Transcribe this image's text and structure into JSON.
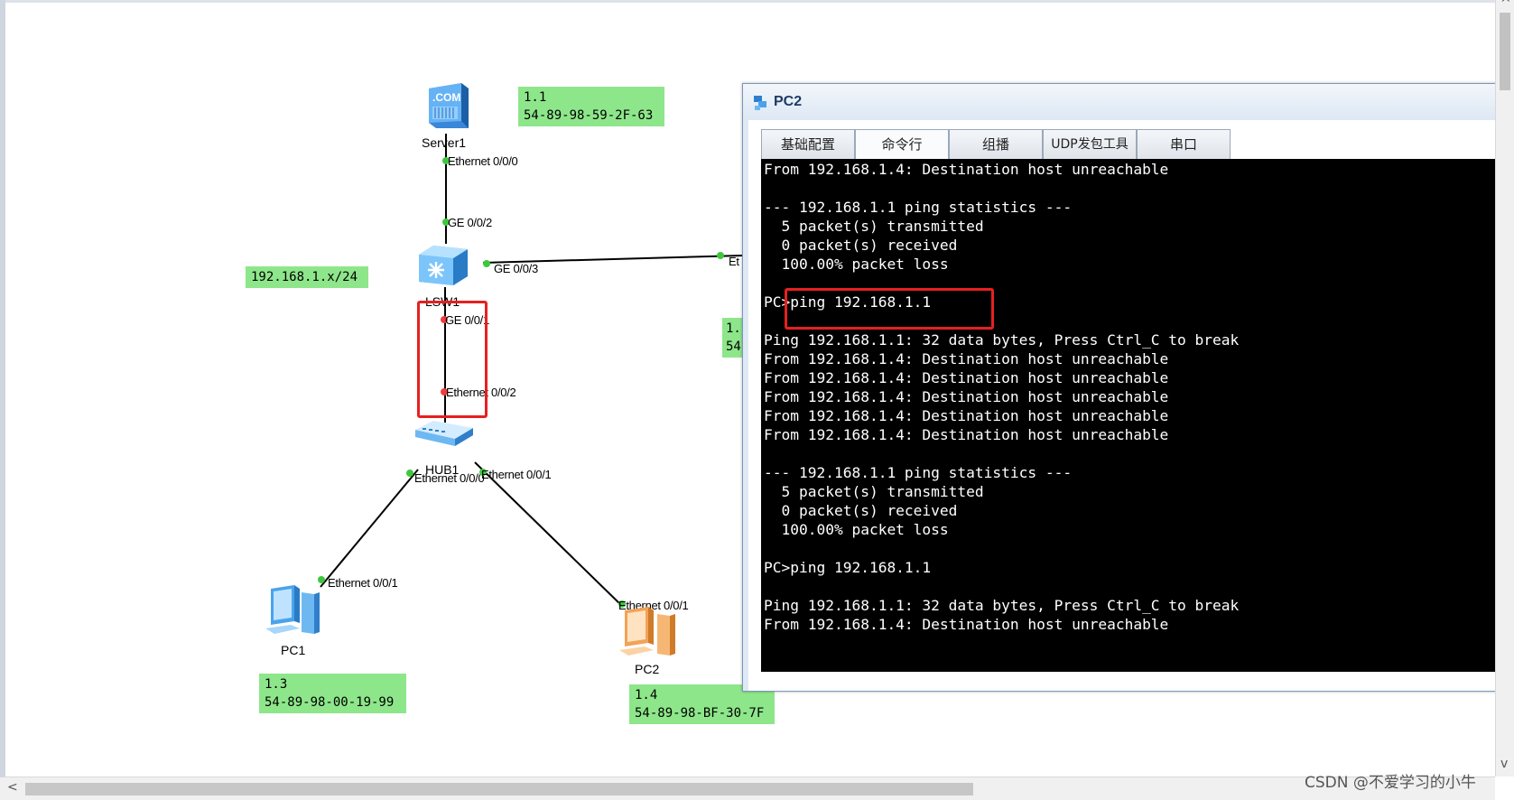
{
  "topology": {
    "devices": {
      "server1": "Server1",
      "lsw1": "LSW1",
      "hub1": "HUB1",
      "pc1": "PC1",
      "pc2": "PC2",
      "server_icon_text": ".COM"
    },
    "ports": {
      "server_eth": "Ethernet 0/0/0",
      "lsw_ge002": "GE 0/0/2",
      "lsw_ge003": "GE 0/0/3",
      "lsw_ge001": "GE 0/0/1",
      "hub_eth002": "Ethernet 0/0/2",
      "hub_eth000": "Ethernet 0/0/0",
      "hub_eth001": "Ethernet 0/0/1",
      "pc1_eth": "Ethernet 0/0/1",
      "pc2_eth": "Ethernet 0/0/1",
      "right_partial": "Et"
    },
    "notes": {
      "server_ip": "1.1",
      "server_mac": "54-89-98-59-2F-63",
      "subnet": "192.168.1.x/24",
      "pc1_ip": "1.3",
      "pc1_mac": "54-89-98-00-19-99",
      "pc2_ip": "1.4",
      "pc2_mac": "54-89-98-BF-30-7F",
      "hidden_ip": "1.",
      "hidden_mac": "54"
    },
    "colors": {
      "note_bg": "#8ee68a",
      "port_up": "#3ec73e",
      "port_down": "#f03c3c",
      "highlight": "#e62020"
    }
  },
  "window": {
    "title": "PC2",
    "icon": "pc-window-icon",
    "tabs": [
      "基础配置",
      "命令行",
      "组播",
      "UDP发包工具",
      "串口"
    ],
    "active_tab": "命令行",
    "terminal_lines": [
      "From 192.168.1.4: Destination host unreachable",
      "",
      "--- 192.168.1.1 ping statistics ---",
      "  5 packet(s) transmitted",
      "  0 packet(s) received",
      "  100.00% packet loss",
      "",
      "PC>ping 192.168.1.1",
      "",
      "Ping 192.168.1.1: 32 data bytes, Press Ctrl_C to break",
      "From 192.168.1.4: Destination host unreachable",
      "From 192.168.1.4: Destination host unreachable",
      "From 192.168.1.4: Destination host unreachable",
      "From 192.168.1.4: Destination host unreachable",
      "From 192.168.1.4: Destination host unreachable",
      "",
      "--- 192.168.1.1 ping statistics ---",
      "  5 packet(s) transmitted",
      "  0 packet(s) received",
      "  100.00% packet loss",
      "",
      "PC>ping 192.168.1.1",
      "",
      "Ping 192.168.1.1: 32 data bytes, Press Ctrl_C to break",
      "From 192.168.1.4: Destination host unreachable"
    ]
  },
  "scrollbars": {
    "left_arrow": "<",
    "up_arrow": "^",
    "down_arrow": "v"
  },
  "watermark": "CSDN @不爱学习的小牛"
}
